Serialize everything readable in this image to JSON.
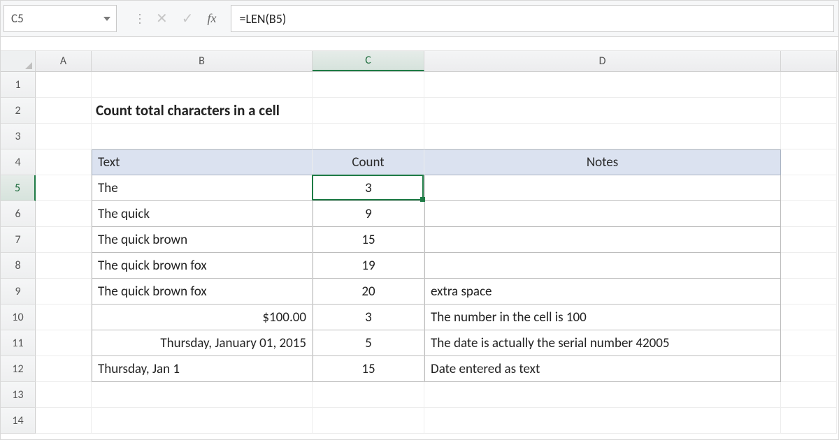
{
  "formula_bar": {
    "cell_ref": "C5",
    "fx_label": "fx",
    "formula": "=LEN(B5)"
  },
  "columns": [
    "A",
    "B",
    "C",
    "D"
  ],
  "active_col": "C",
  "row_numbers": [
    "1",
    "2",
    "3",
    "4",
    "5",
    "6",
    "7",
    "8",
    "9",
    "10",
    "11",
    "12",
    "13",
    "14"
  ],
  "active_row": "5",
  "title": "Count total characters in a cell",
  "table": {
    "headers": {
      "text": "Text",
      "count": "Count",
      "notes": "Notes"
    },
    "rows": [
      {
        "text": "The",
        "count": "3",
        "notes": ""
      },
      {
        "text": "The quick",
        "count": "9",
        "notes": ""
      },
      {
        "text": "The quick brown",
        "count": "15",
        "notes": ""
      },
      {
        "text": "The quick brown fox",
        "count": "19",
        "notes": ""
      },
      {
        "text": "The quick brown  fox",
        "count": "20",
        "notes": "extra space"
      },
      {
        "text": "$100.00",
        "count": "3",
        "notes": "The number in the cell is 100",
        "align": "right"
      },
      {
        "text": "Thursday, January 01, 2015",
        "count": "5",
        "notes": "The date is actually the serial number 42005",
        "align": "right"
      },
      {
        "text": "Thursday, Jan 1",
        "count": "15",
        "notes": "Date entered as text"
      }
    ]
  }
}
